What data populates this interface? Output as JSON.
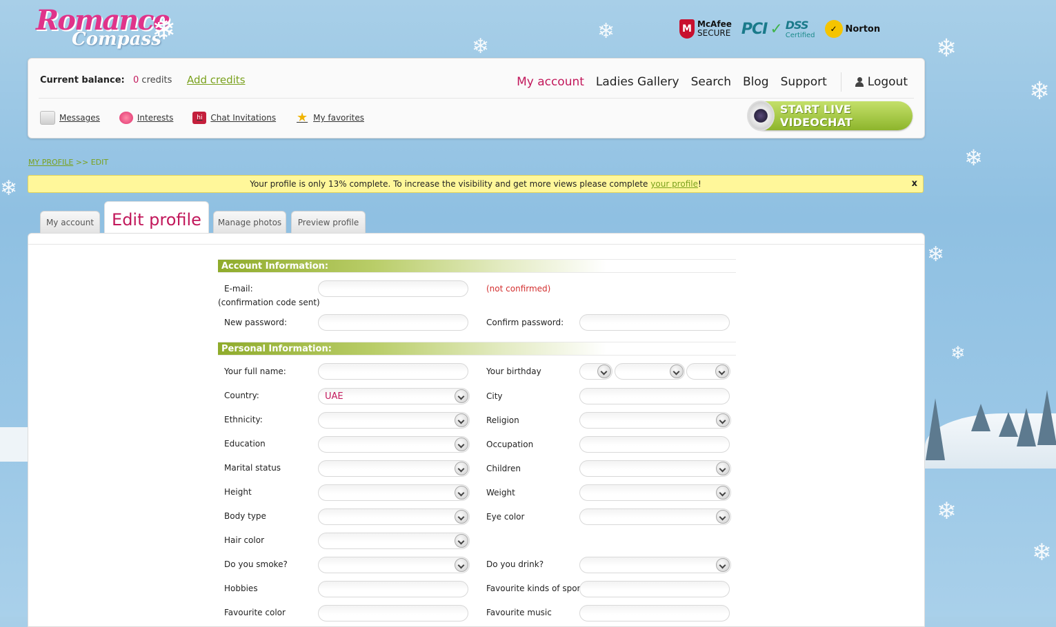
{
  "logo": {
    "line1": "Romance",
    "line2": "Compass"
  },
  "badges": {
    "mcafee_line1": "McAfee",
    "mcafee_line2": "SECURE",
    "pci_main": "PCI",
    "pci_dss": "DSS",
    "pci_sub": "Certified",
    "norton": "Norton"
  },
  "header": {
    "balance_label": "Current balance:",
    "balance_amount": "0",
    "balance_unit": "credits",
    "add_credits": "Add credits",
    "nav": [
      "My account",
      "Ladies Gallery",
      "Search",
      "Blog",
      "Support"
    ],
    "logout": "Logout",
    "subnav": [
      "Messages",
      "Interests",
      "Chat Invitations",
      "My favorites"
    ],
    "videochat": "START LIVE VIDEOCHAT"
  },
  "breadcrumb": {
    "root": "MY PROFILE",
    "sep": ">>",
    "current": "EDIT"
  },
  "notice": {
    "text": "Your profile is only 13% complete. To increase the visibility and get more views please complete ",
    "link": "your profile",
    "end": "!",
    "close": "x"
  },
  "tabs": [
    "My account",
    "Edit profile",
    "Manage photos",
    "Preview profile"
  ],
  "account_section": {
    "title": "Account Information:",
    "email_label": "E-mail:",
    "email_note": "(confirmation code sent)",
    "email_status": "(not confirmed)",
    "new_password": "New password:",
    "confirm_password": "Confirm password:"
  },
  "personal_section": {
    "title": "Personal Information:",
    "full_name": "Your full name:",
    "birthday": "Your birthday",
    "country": "Country:",
    "country_value": "UAE",
    "city": "City",
    "ethnicity": "Ethnicity:",
    "religion": "Religion",
    "education": "Education",
    "occupation": "Occupation",
    "marital": "Marital status",
    "children": "Children",
    "height": "Height",
    "weight": "Weight",
    "body_type": "Body type",
    "eye_color": "Eye color",
    "hair_color": "Hair color",
    "smoke": "Do you smoke?",
    "drink": "Do you drink?",
    "hobbies": "Hobbies",
    "sports": "Favourite kinds of sport",
    "fav_color": "Favourite color",
    "fav_music": "Favourite music"
  }
}
